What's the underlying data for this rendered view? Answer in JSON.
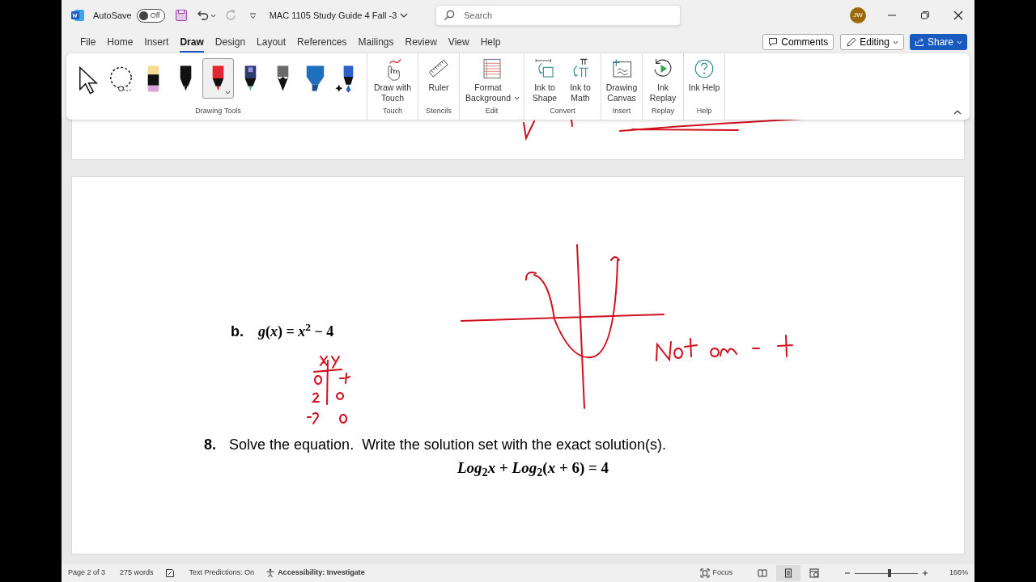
{
  "title_bar": {
    "autosave_label": "AutoSave",
    "autosave_on": false,
    "autosave_state": "Off",
    "document_title": "MAC 1105 Study Guide 4 Fall -3",
    "search_placeholder": "Search",
    "avatar": "JW"
  },
  "menu_tabs": [
    {
      "label": "File",
      "selected": false
    },
    {
      "label": "Home",
      "selected": false
    },
    {
      "label": "Insert",
      "selected": false
    },
    {
      "label": "Draw",
      "selected": true
    },
    {
      "label": "Design",
      "selected": false
    },
    {
      "label": "Layout",
      "selected": false
    },
    {
      "label": "References",
      "selected": false
    },
    {
      "label": "Mailings",
      "selected": false
    },
    {
      "label": "Review",
      "selected": false
    },
    {
      "label": "View",
      "selected": false
    },
    {
      "label": "Help",
      "selected": false
    }
  ],
  "actions": {
    "comments": "Comments",
    "editing": "Editing",
    "share": "Share"
  },
  "ribbon": {
    "drawing_tools": {
      "label": "Drawing Tools",
      "tools": [
        {
          "kind": "select",
          "selected": false
        },
        {
          "kind": "lasso",
          "selected": false
        },
        {
          "kind": "eraser",
          "selected": false
        },
        {
          "kind": "pen",
          "color": "#111111",
          "selected": false
        },
        {
          "kind": "pen",
          "color": "#e3262f",
          "selected": true
        },
        {
          "kind": "galaxy",
          "color": "#2b3b6b",
          "selected": false
        },
        {
          "kind": "pencil",
          "color": "#6b6b6b",
          "selected": false
        },
        {
          "kind": "highlighter",
          "color": "#1f6fbf",
          "selected": false
        },
        {
          "kind": "action",
          "color": "#2a62c9",
          "selected": false
        }
      ]
    },
    "groups": [
      {
        "label": "Touch",
        "buttons": [
          {
            "kind": "touch",
            "label": "Draw with Touch"
          }
        ]
      },
      {
        "label": "Stencils",
        "buttons": [
          {
            "kind": "ruler",
            "label": "Ruler"
          }
        ]
      },
      {
        "label": "Edit",
        "buttons": [
          {
            "kind": "background",
            "label": "Format Background",
            "dropdown": true
          }
        ]
      },
      {
        "label": "Convert",
        "buttons": [
          {
            "kind": "shape",
            "label": "Ink to Shape"
          },
          {
            "kind": "math",
            "label": "Ink to Math"
          }
        ]
      },
      {
        "label": "Insert",
        "buttons": [
          {
            "kind": "canvas",
            "label": "Drawing Canvas"
          }
        ]
      },
      {
        "label": "Replay",
        "buttons": [
          {
            "kind": "replay",
            "label": "Ink Replay"
          }
        ]
      },
      {
        "label": "Help",
        "buttons": [
          {
            "kind": "help",
            "label": "Ink Help"
          }
        ]
      }
    ]
  },
  "document": {
    "item_b": {
      "label": "b.",
      "equation": "*g*(*x*) = *x*$^{2}$ − 4"
    },
    "item_8": {
      "number": "8.",
      "text": "Solve the equation.  Write the solution set with the exact solution(s).",
      "equation": "*Log*$_{2}$*x* + *Log*$_{2}$(*x* + 6) = 4"
    }
  },
  "status_bar": {
    "page": "Page 2 of 3",
    "words": "275 words",
    "predictions": "Text Predictions: On",
    "accessibility": "Accessibility: Investigate",
    "focus": "Focus",
    "views": [
      {
        "kind": "read",
        "selected": false
      },
      {
        "kind": "print",
        "selected": true
      },
      {
        "kind": "web",
        "selected": false
      }
    ],
    "zoom_slider": {
      "level": 0.55
    },
    "zoom": "166%"
  }
}
